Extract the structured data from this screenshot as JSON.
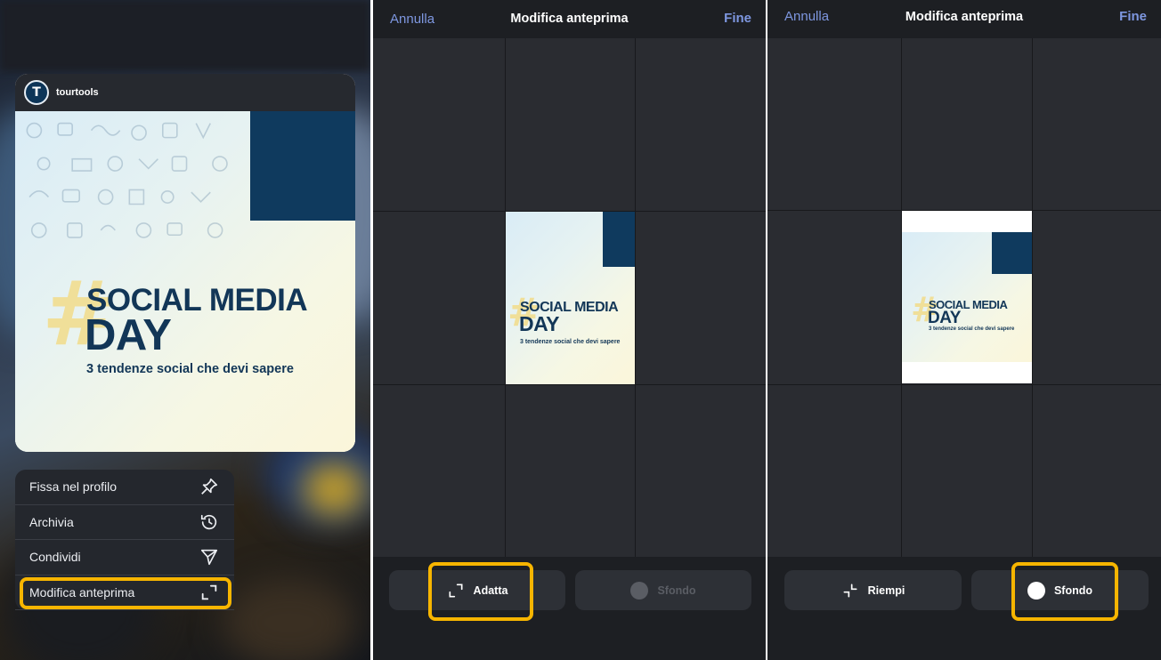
{
  "post": {
    "username": "tourtools",
    "avatar_glyph": "T",
    "image": {
      "hashtag": "#",
      "title_line1": "SOCIAL MEDIA",
      "title_line2": "DAY",
      "subtitle": "3 tendenze social che devi sapere",
      "colors": {
        "navy": "#0f3a5e",
        "yellow": "#f2dc8a"
      }
    }
  },
  "context_menu": {
    "items": [
      {
        "label": "Fissa nel profilo",
        "icon": "pin-icon"
      },
      {
        "label": "Archivia",
        "icon": "history-icon"
      },
      {
        "label": "Condividi",
        "icon": "send-icon"
      },
      {
        "label": "Modifica anteprima",
        "icon": "expand-icon"
      }
    ],
    "highlighted": "Modifica anteprima"
  },
  "editor_fit": {
    "cancel": "Annulla",
    "title": "Modifica anteprima",
    "done": "Fine",
    "buttons": {
      "primary": "Adatta",
      "secondary": "Sfondo"
    },
    "secondary_enabled": false
  },
  "editor_background": {
    "cancel": "Annulla",
    "title": "Modifica anteprima",
    "done": "Fine",
    "buttons": {
      "primary": "Riempi",
      "secondary": "Sfondo"
    },
    "secondary_enabled": true
  },
  "colors": {
    "highlight": "#f7b500",
    "link": "#7e97e0",
    "editor_bg": "#2a2c31"
  }
}
